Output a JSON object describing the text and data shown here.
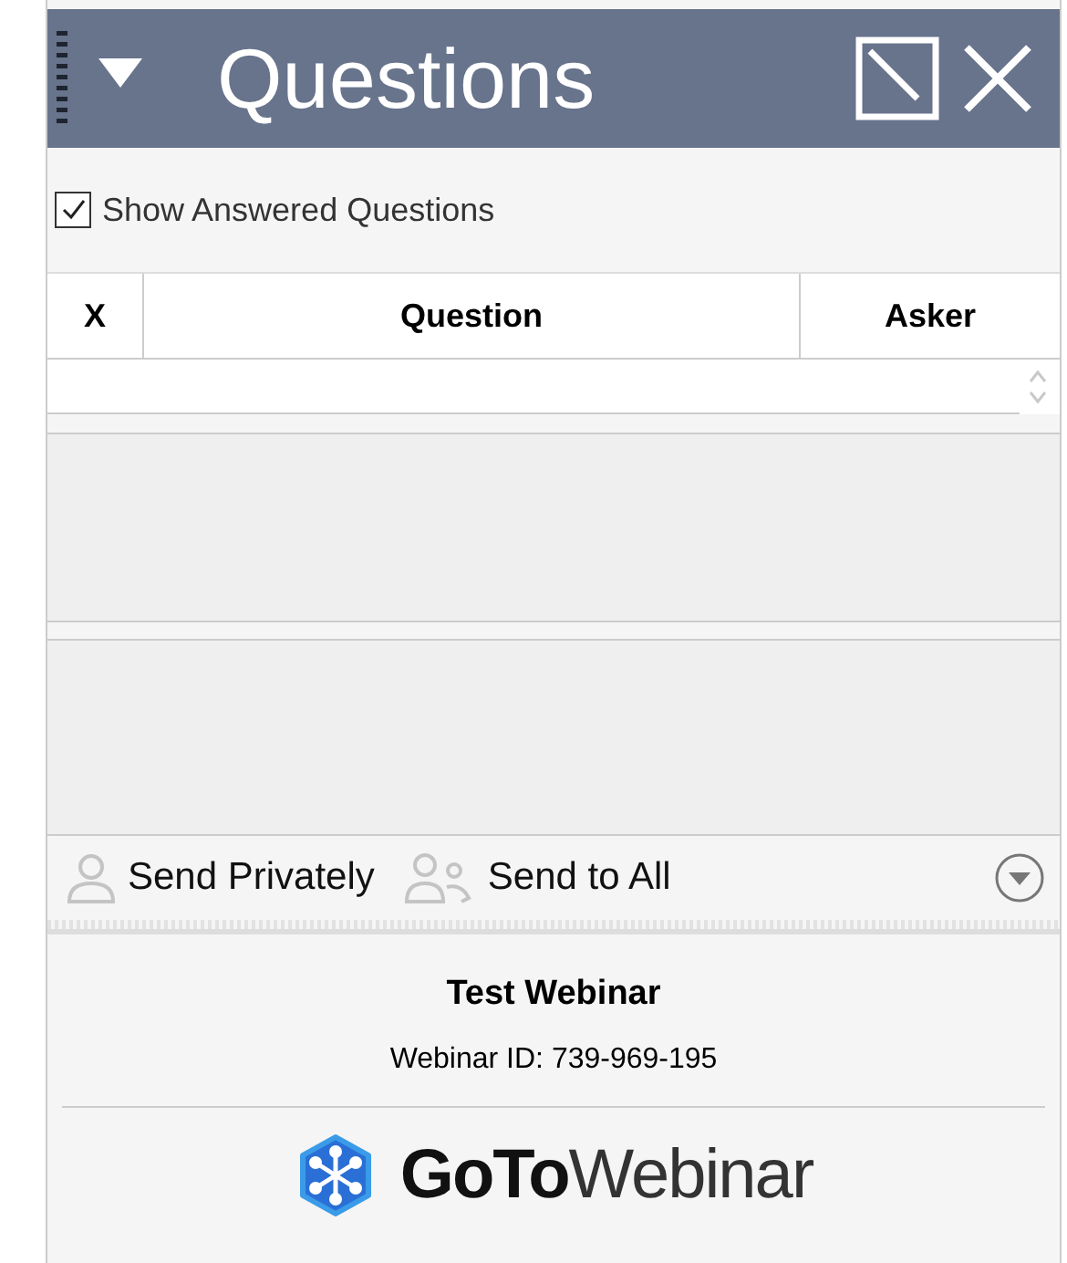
{
  "header": {
    "title": "Questions"
  },
  "show_answered": {
    "label": "Show Answered Questions",
    "checked": true
  },
  "table": {
    "columns": [
      "X",
      "Question",
      "Asker"
    ]
  },
  "send": {
    "private_label": "Send Privately",
    "all_label": "Send to All"
  },
  "footer": {
    "webinar_title": "Test Webinar",
    "webinar_id": "Webinar ID: 739-969-195",
    "logo": "**GoTo**Webinar"
  }
}
